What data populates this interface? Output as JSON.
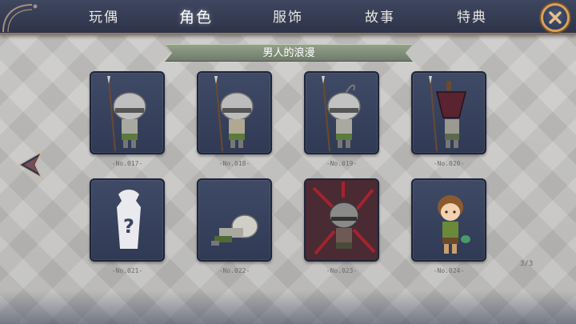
{
  "nav": {
    "tabs": [
      "玩偶",
      "角色",
      "服饰",
      "故事",
      "特典"
    ],
    "active_tab": "角色"
  },
  "section": {
    "title": "男人的浪漫"
  },
  "cards": [
    {
      "number": "-No.017-",
      "content": "helmet-spear-soldier"
    },
    {
      "number": "-No.018-",
      "content": "helmet-spear-soldier"
    },
    {
      "number": "-No.019-",
      "content": "feathered-helmet-spear-soldier"
    },
    {
      "number": "-No.020-",
      "content": "pot-helmet-spear-soldier"
    },
    {
      "number": "-No.021-",
      "content": "locked-silhouette"
    },
    {
      "number": "-No.022-",
      "content": "crawling-soldier"
    },
    {
      "number": "-No.023-",
      "content": "wounded-soldier-red-aura"
    },
    {
      "number": "-No.024-",
      "content": "brown-haired-boy"
    }
  ],
  "pagination": {
    "indicator": "3/3"
  },
  "icons": {
    "close": "close-x-icon",
    "prev": "left-arrow-icon",
    "locked": "question-silhouette-icon"
  },
  "colors": {
    "nav_bg": "#353c55",
    "accent_gold": "#d9a25a",
    "ribbon": "#7f8c78",
    "card_bg": "#384260"
  }
}
